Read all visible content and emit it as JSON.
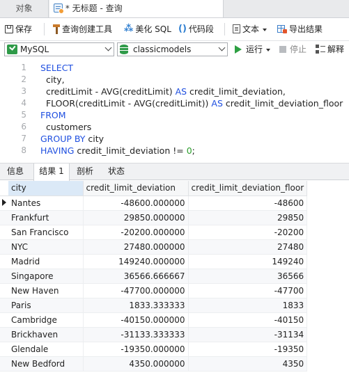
{
  "window": {
    "objects_tab_label": "对象",
    "query_tab_label": "* 无标题 - 查询"
  },
  "toolbar": {
    "save_label": "保存",
    "query_builder_label": "查询创建工具",
    "beautify_label": "美化 SQL",
    "snippet_label": "代码段",
    "text_label": "文本",
    "export_label": "导出结果"
  },
  "connection": {
    "server": "MySQL",
    "database": "classicmodels",
    "run_label": "运行",
    "stop_label": "停止",
    "explain_label": "解释"
  },
  "editor": {
    "lines": [
      {
        "num": "1",
        "parts": [
          {
            "t": "SELECT",
            "k": "kw"
          }
        ]
      },
      {
        "num": "2",
        "parts": [
          {
            "t": "  city,",
            "k": ""
          }
        ]
      },
      {
        "num": "3",
        "parts": [
          {
            "t": "  creditLimit - AVG(creditLimit) ",
            "k": ""
          },
          {
            "t": "AS",
            "k": "kw"
          },
          {
            "t": " credit_limit_deviation,",
            "k": ""
          }
        ]
      },
      {
        "num": "4",
        "parts": [
          {
            "t": "  FLOOR(creditLimit - AVG(creditLimit)) ",
            "k": ""
          },
          {
            "t": "AS",
            "k": "kw"
          },
          {
            "t": " credit_limit_deviation_floor",
            "k": ""
          }
        ]
      },
      {
        "num": "5",
        "parts": [
          {
            "t": "FROM",
            "k": "kw"
          }
        ]
      },
      {
        "num": "6",
        "parts": [
          {
            "t": "  customers",
            "k": ""
          }
        ]
      },
      {
        "num": "7",
        "parts": [
          {
            "t": "GROUP BY",
            "k": "kw"
          },
          {
            "t": " city",
            "k": ""
          }
        ]
      },
      {
        "num": "8",
        "parts": [
          {
            "t": "HAVING",
            "k": "kw"
          },
          {
            "t": " credit_limit_deviation != ",
            "k": ""
          },
          {
            "t": "0",
            "k": "num"
          },
          {
            "t": ";",
            "k": ""
          }
        ]
      }
    ]
  },
  "result_tabs": [
    "信息",
    "结果 1",
    "剖析",
    "状态"
  ],
  "active_result_tab": "结果 1",
  "grid": {
    "columns": [
      "city",
      "credit_limit_deviation",
      "credit_limit_deviation_floor"
    ],
    "rows": [
      [
        "Nantes",
        "-48600.000000",
        "-48600"
      ],
      [
        "Frankfurt",
        "29850.000000",
        "29850"
      ],
      [
        "San Francisco",
        "-20200.000000",
        "-20200"
      ],
      [
        "NYC",
        "27480.000000",
        "27480"
      ],
      [
        "Madrid",
        "149240.000000",
        "149240"
      ],
      [
        "Singapore",
        "36566.666667",
        "36566"
      ],
      [
        "New Haven",
        "-47700.000000",
        "-47700"
      ],
      [
        "Paris",
        "1833.333333",
        "1833"
      ],
      [
        "Cambridge",
        "-40150.000000",
        "-40150"
      ],
      [
        "Brickhaven",
        "-31133.333333",
        "-31134"
      ],
      [
        "Glendale",
        "-19350.000000",
        "-19350"
      ],
      [
        "New Bedford",
        "4350.000000",
        "4350"
      ]
    ]
  },
  "colors": {
    "keyword": "#1f4fe0",
    "number": "#2a9d2a",
    "run_icon": "#2ea043"
  }
}
